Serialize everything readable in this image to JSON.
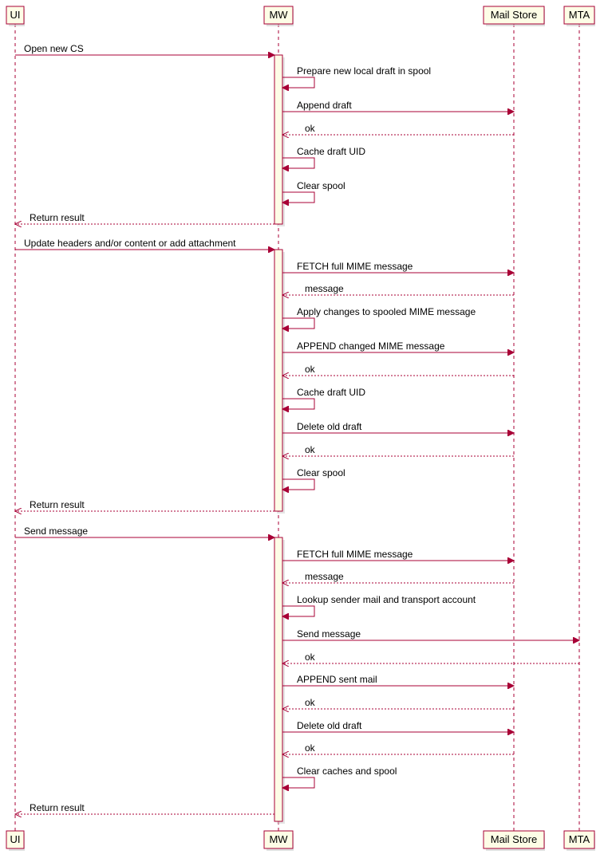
{
  "participants": {
    "p0": "UI",
    "p1": "MW",
    "p2": "Mail Store",
    "p3": "MTA"
  },
  "messages": {
    "m0": "Open new CS",
    "m1": "Prepare new local draft in spool",
    "m2": "Append draft",
    "m3": "ok",
    "m4": "Cache draft UID",
    "m5": "Clear spool",
    "m6": "Return result",
    "m7": "Update headers and/or content or add attachment",
    "m8": "FETCH full MIME message",
    "m9": "message",
    "m10": "Apply changes to spooled MIME message",
    "m11": "APPEND changed MIME message",
    "m12": "ok",
    "m13": "Cache draft UID",
    "m14": "Delete old draft",
    "m15": "ok",
    "m16": "Clear spool",
    "m17": "Return result",
    "m18": "Send message",
    "m19": "FETCH full MIME message",
    "m20": "message",
    "m21": "Lookup sender mail and transport account",
    "m22": "Send message",
    "m23": "ok",
    "m24": "APPEND sent mail",
    "m25": "ok",
    "m26": "Delete old draft",
    "m27": "ok",
    "m28": "Clear caches and spool",
    "m29": "Return result"
  }
}
